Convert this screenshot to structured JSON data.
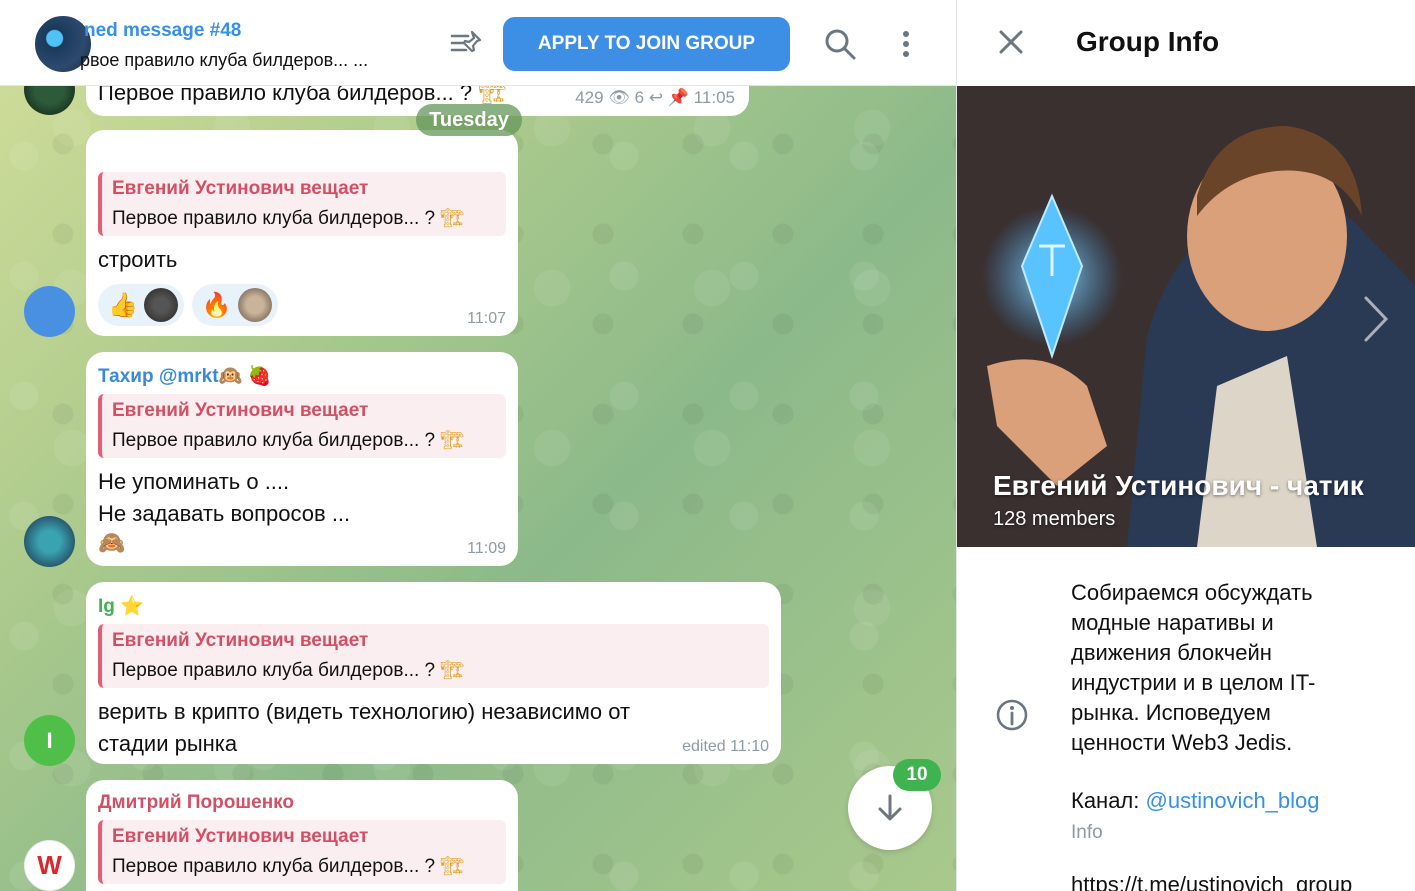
{
  "topbar": {
    "pinned_title": "ned message #48",
    "pinned_text": "рвое правило клуба билдеров... ...",
    "join_label": "APPLY TO JOIN GROUP"
  },
  "top_message": {
    "text": "Первое правило клуба билдеров... ?",
    "views": "429",
    "replies": "6",
    "time": "11:05"
  },
  "day_label": "Tuesday",
  "messages": [
    {
      "sender": "",
      "reply_author": "Евгений Устинович вещает",
      "reply_text": "Первое правило клуба билдеров... ?",
      "text": "строить",
      "reactions": [
        {
          "emoji": "👍"
        },
        {
          "emoji": "🔥"
        }
      ],
      "time": "11:07"
    },
    {
      "sender": "Тахир @mrkt🙉",
      "sender_emoji": "🍓",
      "reply_author": "Евгений Устинович вещает",
      "reply_text": "Первое правило клуба билдеров... ?",
      "text_line1": "Не упоминать о ....",
      "text_line2": "Не задавать вопросов ...",
      "sticker": "🙈",
      "time": "11:09"
    },
    {
      "sender": "Ig",
      "sender_emoji": "⭐",
      "reply_author": "Евгений Устинович вещает",
      "reply_text": "Первое правило клуба билдеров... ?",
      "text": "верить в крипто (видеть технологию) независимо от стадии рынка",
      "time": "edited 11:10",
      "avatar_letter": "I"
    },
    {
      "sender": "Дмитрий Порошенко",
      "reply_author": "Евгений Устинович вещает",
      "reply_text": "Первое правило клуба билдеров... ?",
      "avatar_letter": "W"
    }
  ],
  "unread_count": "10",
  "info_panel": {
    "title": "Group Info",
    "group_name": "Евгений Устинович - чатик",
    "members": "128 members",
    "description": "Собираемся обсуждать модные наративы и движения блокчейн индустрии и в целом IT-рынка. Исповедуем ценности Web3 Jedis.",
    "channel_label": "Канал:",
    "channel_handle": "@ustinovich_blog",
    "info_label": "Info",
    "link": "https://t.me/ustinovich_group"
  },
  "colors": {
    "accent": "#3390ec",
    "join_button": "#3d8fe6",
    "reply_bar": "#e35e73",
    "sender_blue": "#3a8ad6",
    "sender_green": "#3fb34f",
    "sender_pink": "#d44f63",
    "badge": "#3fb34f"
  },
  "icons": [
    "pinned-list-icon",
    "search-icon",
    "menu-icon",
    "close-icon",
    "info-icon",
    "arrow-down-icon",
    "chevron-right-icon",
    "eye-icon",
    "reply-icon",
    "pin-icon"
  ]
}
